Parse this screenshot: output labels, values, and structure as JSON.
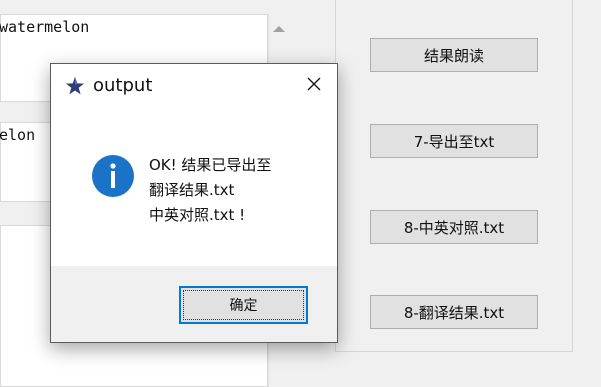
{
  "background_app": {
    "text_area_1": {
      "value": "watermelon"
    },
    "text_area_2": {
      "value": "elon"
    },
    "buttons": [
      {
        "label": "结果朗读"
      },
      {
        "label": "7-导出至txt"
      },
      {
        "label": "8-中英对照.txt"
      },
      {
        "label": "8-翻译结果.txt"
      }
    ]
  },
  "dialog": {
    "title": "output",
    "message_lines": [
      "OK! 结果已导出至",
      "翻译结果.txt",
      "中英对照.txt !"
    ],
    "ok_label": "确定",
    "icons": {
      "app": "feather-star-icon",
      "close": "close-icon",
      "message": "info-icon"
    },
    "colors": {
      "info_icon": "#1a73c7",
      "focus_border": "#0078d7"
    }
  }
}
